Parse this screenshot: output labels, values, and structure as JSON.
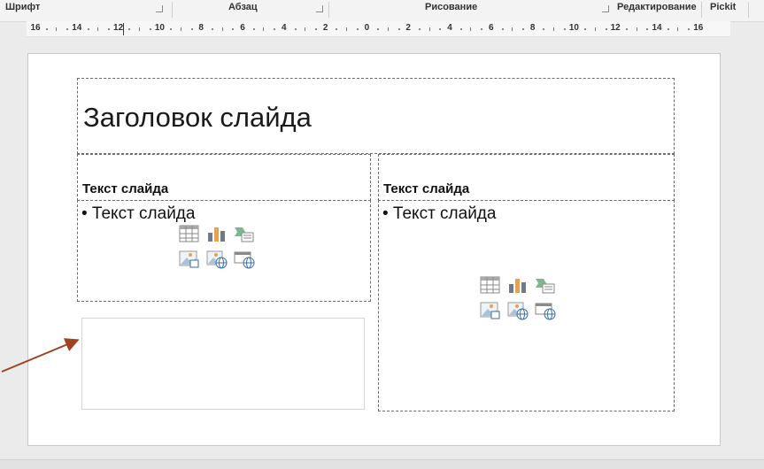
{
  "ribbon": {
    "groups": [
      "Шрифт",
      "Абзац",
      "Рисование",
      "Редактирование",
      "Pickit"
    ]
  },
  "ruler": {
    "left_labels": [
      "16",
      "14",
      "12",
      "10",
      "8",
      "6",
      "4",
      "2"
    ],
    "center_label": "0",
    "right_labels": [
      "2",
      "4",
      "6",
      "8",
      "10",
      "12",
      "14",
      "16"
    ]
  },
  "slide": {
    "title": "Заголовок слайда",
    "left": {
      "heading": "Текст слайда",
      "body": "• Текст слайда"
    },
    "right": {
      "heading": "Текст слайда",
      "body": "• Текст слайда"
    }
  },
  "content_icons": [
    "table-icon",
    "chart-icon",
    "smartart-icon",
    "picture-icon",
    "online-picture-icon",
    "video-icon"
  ],
  "colors": {
    "arrow": "#a0421e",
    "ruler_marker": "#c00000"
  }
}
